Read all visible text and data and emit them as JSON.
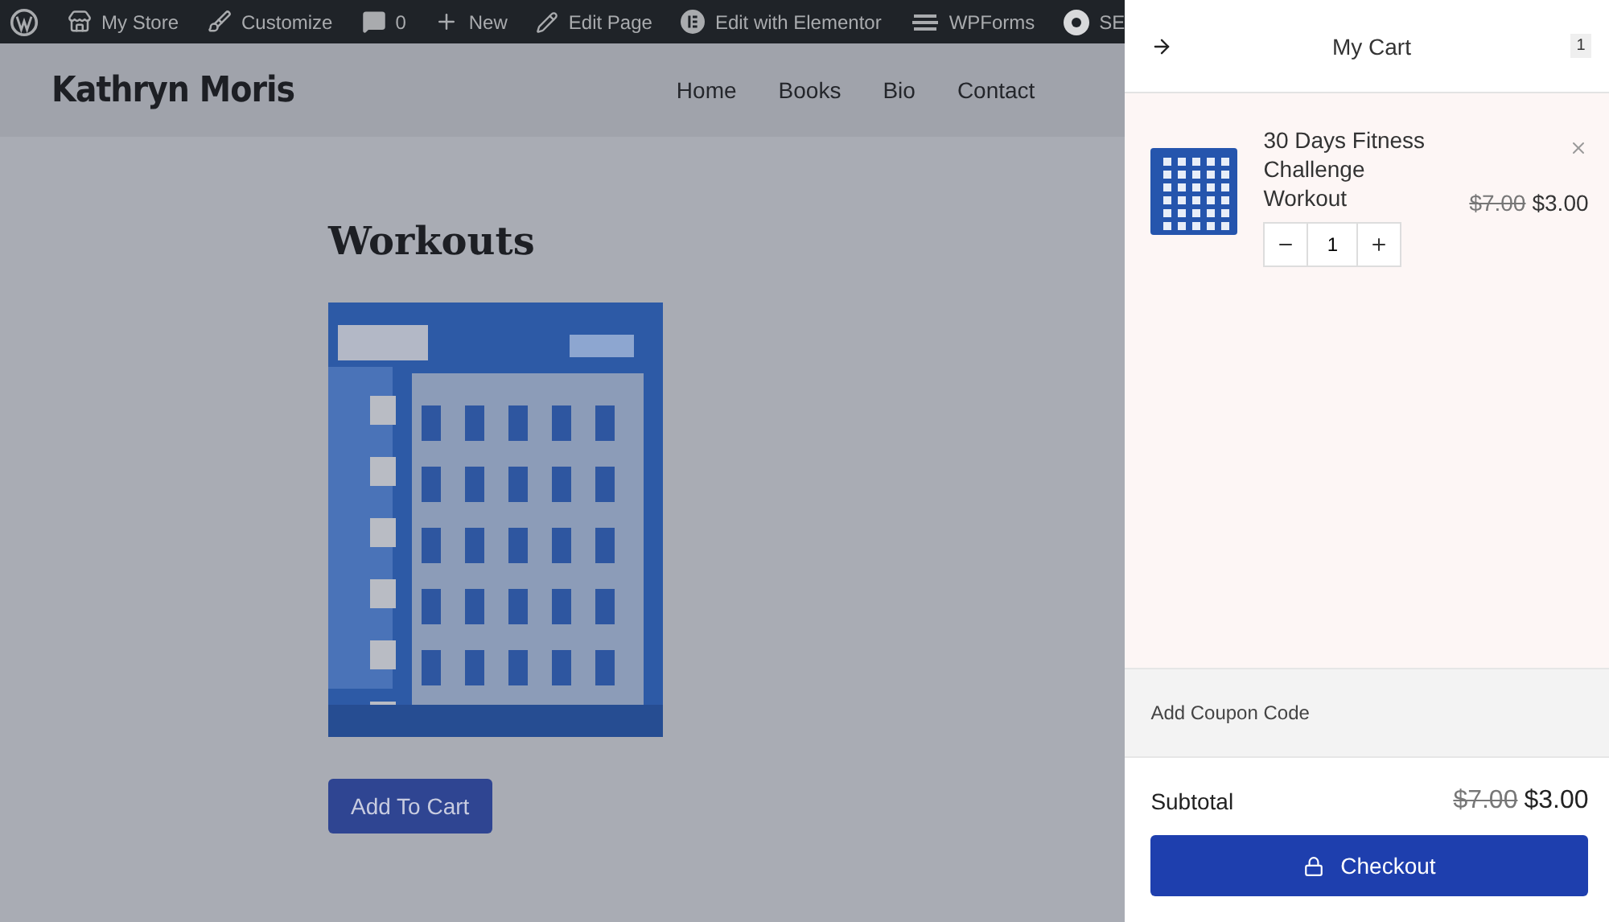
{
  "admin_bar": {
    "items": [
      {
        "kind": "logo"
      },
      {
        "kind": "store",
        "label": "My Store"
      },
      {
        "kind": "brush",
        "label": "Customize"
      },
      {
        "kind": "comment",
        "label": "0"
      },
      {
        "kind": "plus",
        "label": "New"
      },
      {
        "kind": "pencil",
        "label": "Edit Page"
      },
      {
        "kind": "elementor",
        "label": "Edit with Elementor"
      },
      {
        "kind": "forms",
        "label": "WPForms"
      },
      {
        "kind": "seo",
        "label": "SE"
      }
    ]
  },
  "site": {
    "title": "Kathryn Moris",
    "nav": [
      {
        "label": "Home"
      },
      {
        "label": "Books"
      },
      {
        "label": "Bio"
      },
      {
        "label": "Contact"
      }
    ]
  },
  "page": {
    "heading": "Workouts",
    "button": "Add To Cart"
  },
  "cart": {
    "title": "My Cart",
    "count": "1",
    "items": [
      {
        "name": "30 Days Fitness Challenge Workout",
        "old_price": "$7.00",
        "price": "$3.00",
        "quantity": "1"
      }
    ],
    "coupon": "Add Coupon Code",
    "subtotal_label": "Subtotal",
    "subtotal_old": "$7.00",
    "subtotal": "$3.00",
    "checkout": "Checkout"
  }
}
